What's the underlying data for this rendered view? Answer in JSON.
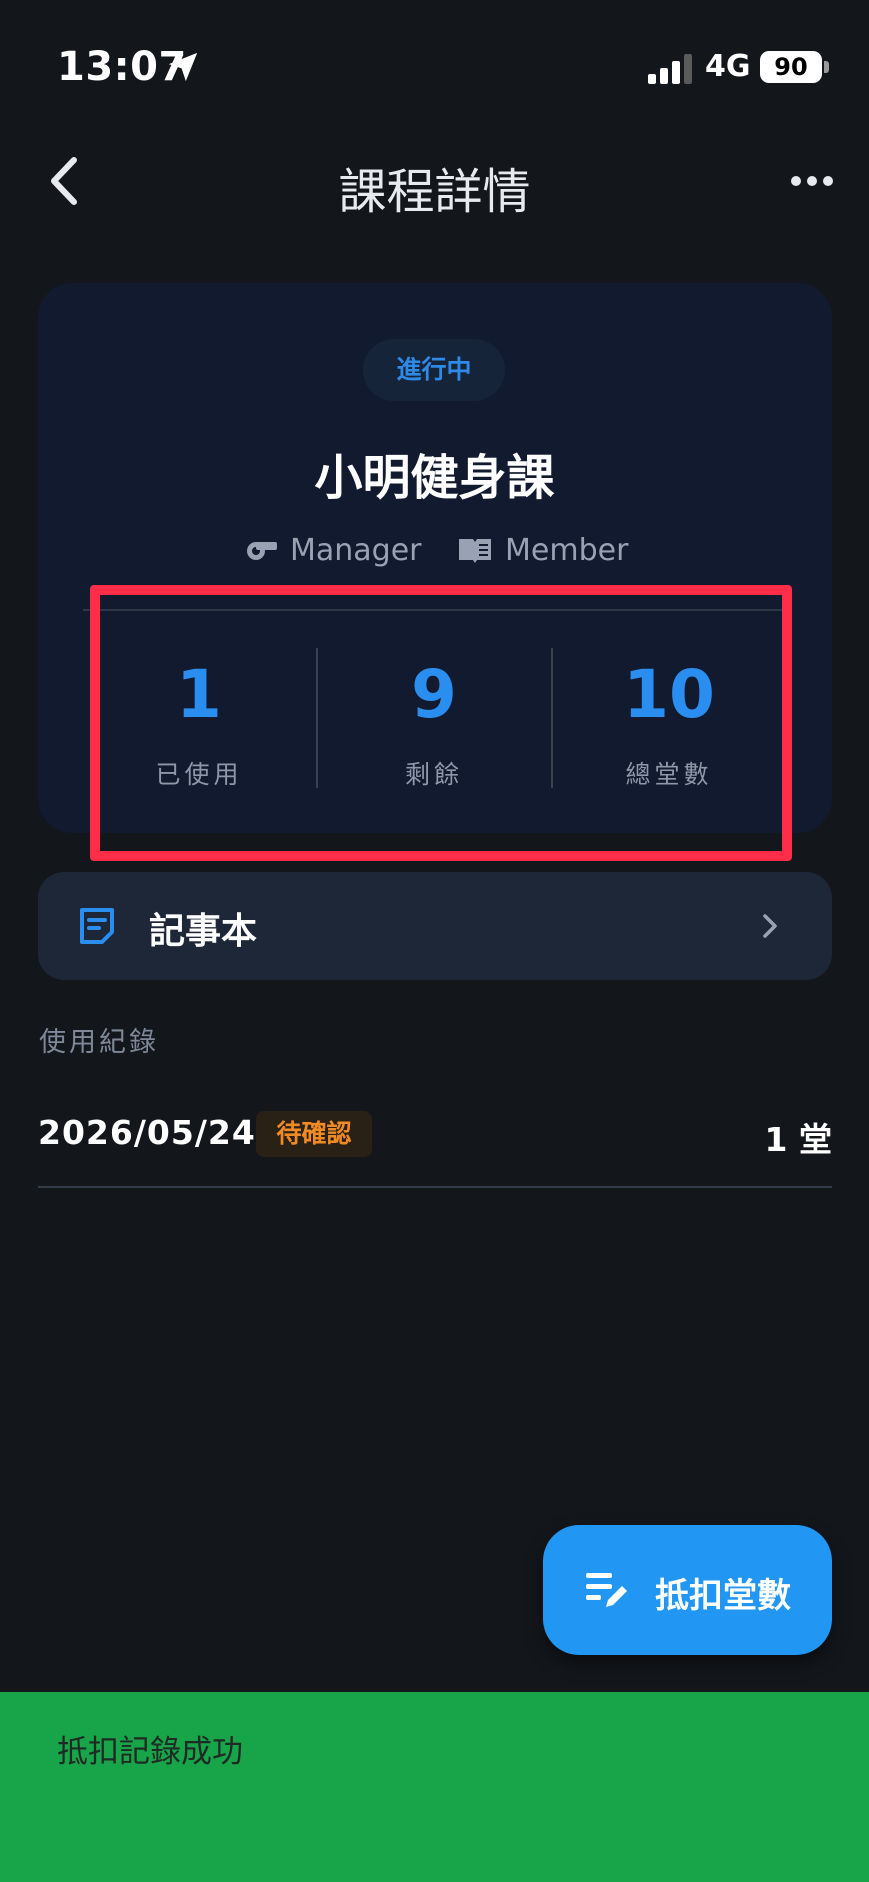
{
  "status_bar": {
    "time": "13:07",
    "network": "4G",
    "battery": "90"
  },
  "header": {
    "title": "課程詳情",
    "back_icon": "chevron-left-icon",
    "more_icon": "ellipsis-icon"
  },
  "course": {
    "status": "進行中",
    "name": "小明健身課",
    "roles": [
      {
        "icon": "whistle-icon",
        "label": "Manager"
      },
      {
        "icon": "book-icon",
        "label": "Member"
      }
    ],
    "stats": [
      {
        "value": "1",
        "label": "已使用"
      },
      {
        "value": "9",
        "label": "剩餘"
      },
      {
        "value": "10",
        "label": "總堂數"
      }
    ]
  },
  "notebook": {
    "icon": "note-icon",
    "label": "記事本"
  },
  "usage": {
    "title": "使用紀錄",
    "records": [
      {
        "date": "2026/05/24",
        "status": "待確認",
        "count": "1 堂"
      }
    ]
  },
  "fab": {
    "icon": "edit-list-icon",
    "label": "抵扣堂數"
  },
  "snackbar": {
    "message": "抵扣記錄成功"
  },
  "colors": {
    "background": "#13161b",
    "card": "#111a2e",
    "accent": "#2196f3",
    "pending": "#f08a24",
    "highlight": "#ff2d48",
    "snackbar": "#18a549"
  }
}
